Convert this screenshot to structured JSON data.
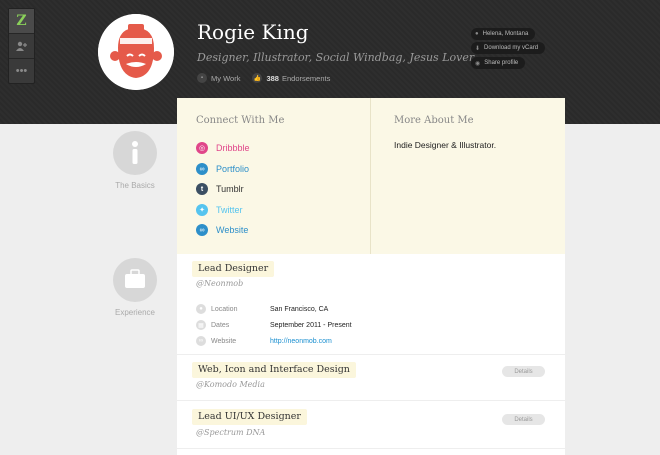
{
  "profile": {
    "name": "Rogie King",
    "tagline": "Designer, Illustrator, Social Windbag, Jesus Lover",
    "my_work": "My Work",
    "endorsements_count": "388",
    "endorsements_label": "Endorsements"
  },
  "actions": {
    "location": "Helena, Montana",
    "download": "Download my vCard",
    "share": "Share profile"
  },
  "nav": {
    "logo": "Z"
  },
  "connect": {
    "title": "Connect With Me",
    "links": [
      {
        "label": "Dribbble",
        "color": "#e0468a"
      },
      {
        "label": "Portfolio",
        "color": "#2d8fc9"
      },
      {
        "label": "Tumblr",
        "color": "#3b4f63"
      },
      {
        "label": "Twitter",
        "color": "#55c4ef"
      },
      {
        "label": "Website",
        "color": "#2d8fc9"
      }
    ]
  },
  "about": {
    "title": "More About Me",
    "text": "Indie Designer & Illustrator."
  },
  "sections": {
    "basics": "The Basics",
    "experience": "Experience"
  },
  "jobs": [
    {
      "title": "Lead Designer",
      "company": "@Neonmob",
      "details": [
        {
          "label": "Location",
          "value": "San Francisco, CA"
        },
        {
          "label": "Dates",
          "value": "September 2011 - Present"
        },
        {
          "label": "Website",
          "value": "http://neonmob.com"
        }
      ]
    },
    {
      "title": "Web, Icon and Interface Design",
      "company": "@Komodo Media",
      "button": "Details"
    },
    {
      "title": "Lead UI/UX Designer",
      "company": "@Spectrum DNA",
      "button": "Details"
    }
  ],
  "colors": {
    "header_bg": "#2b2b2b",
    "link_blue": "#1a8fd0",
    "highlight": "#fbf8e6"
  }
}
